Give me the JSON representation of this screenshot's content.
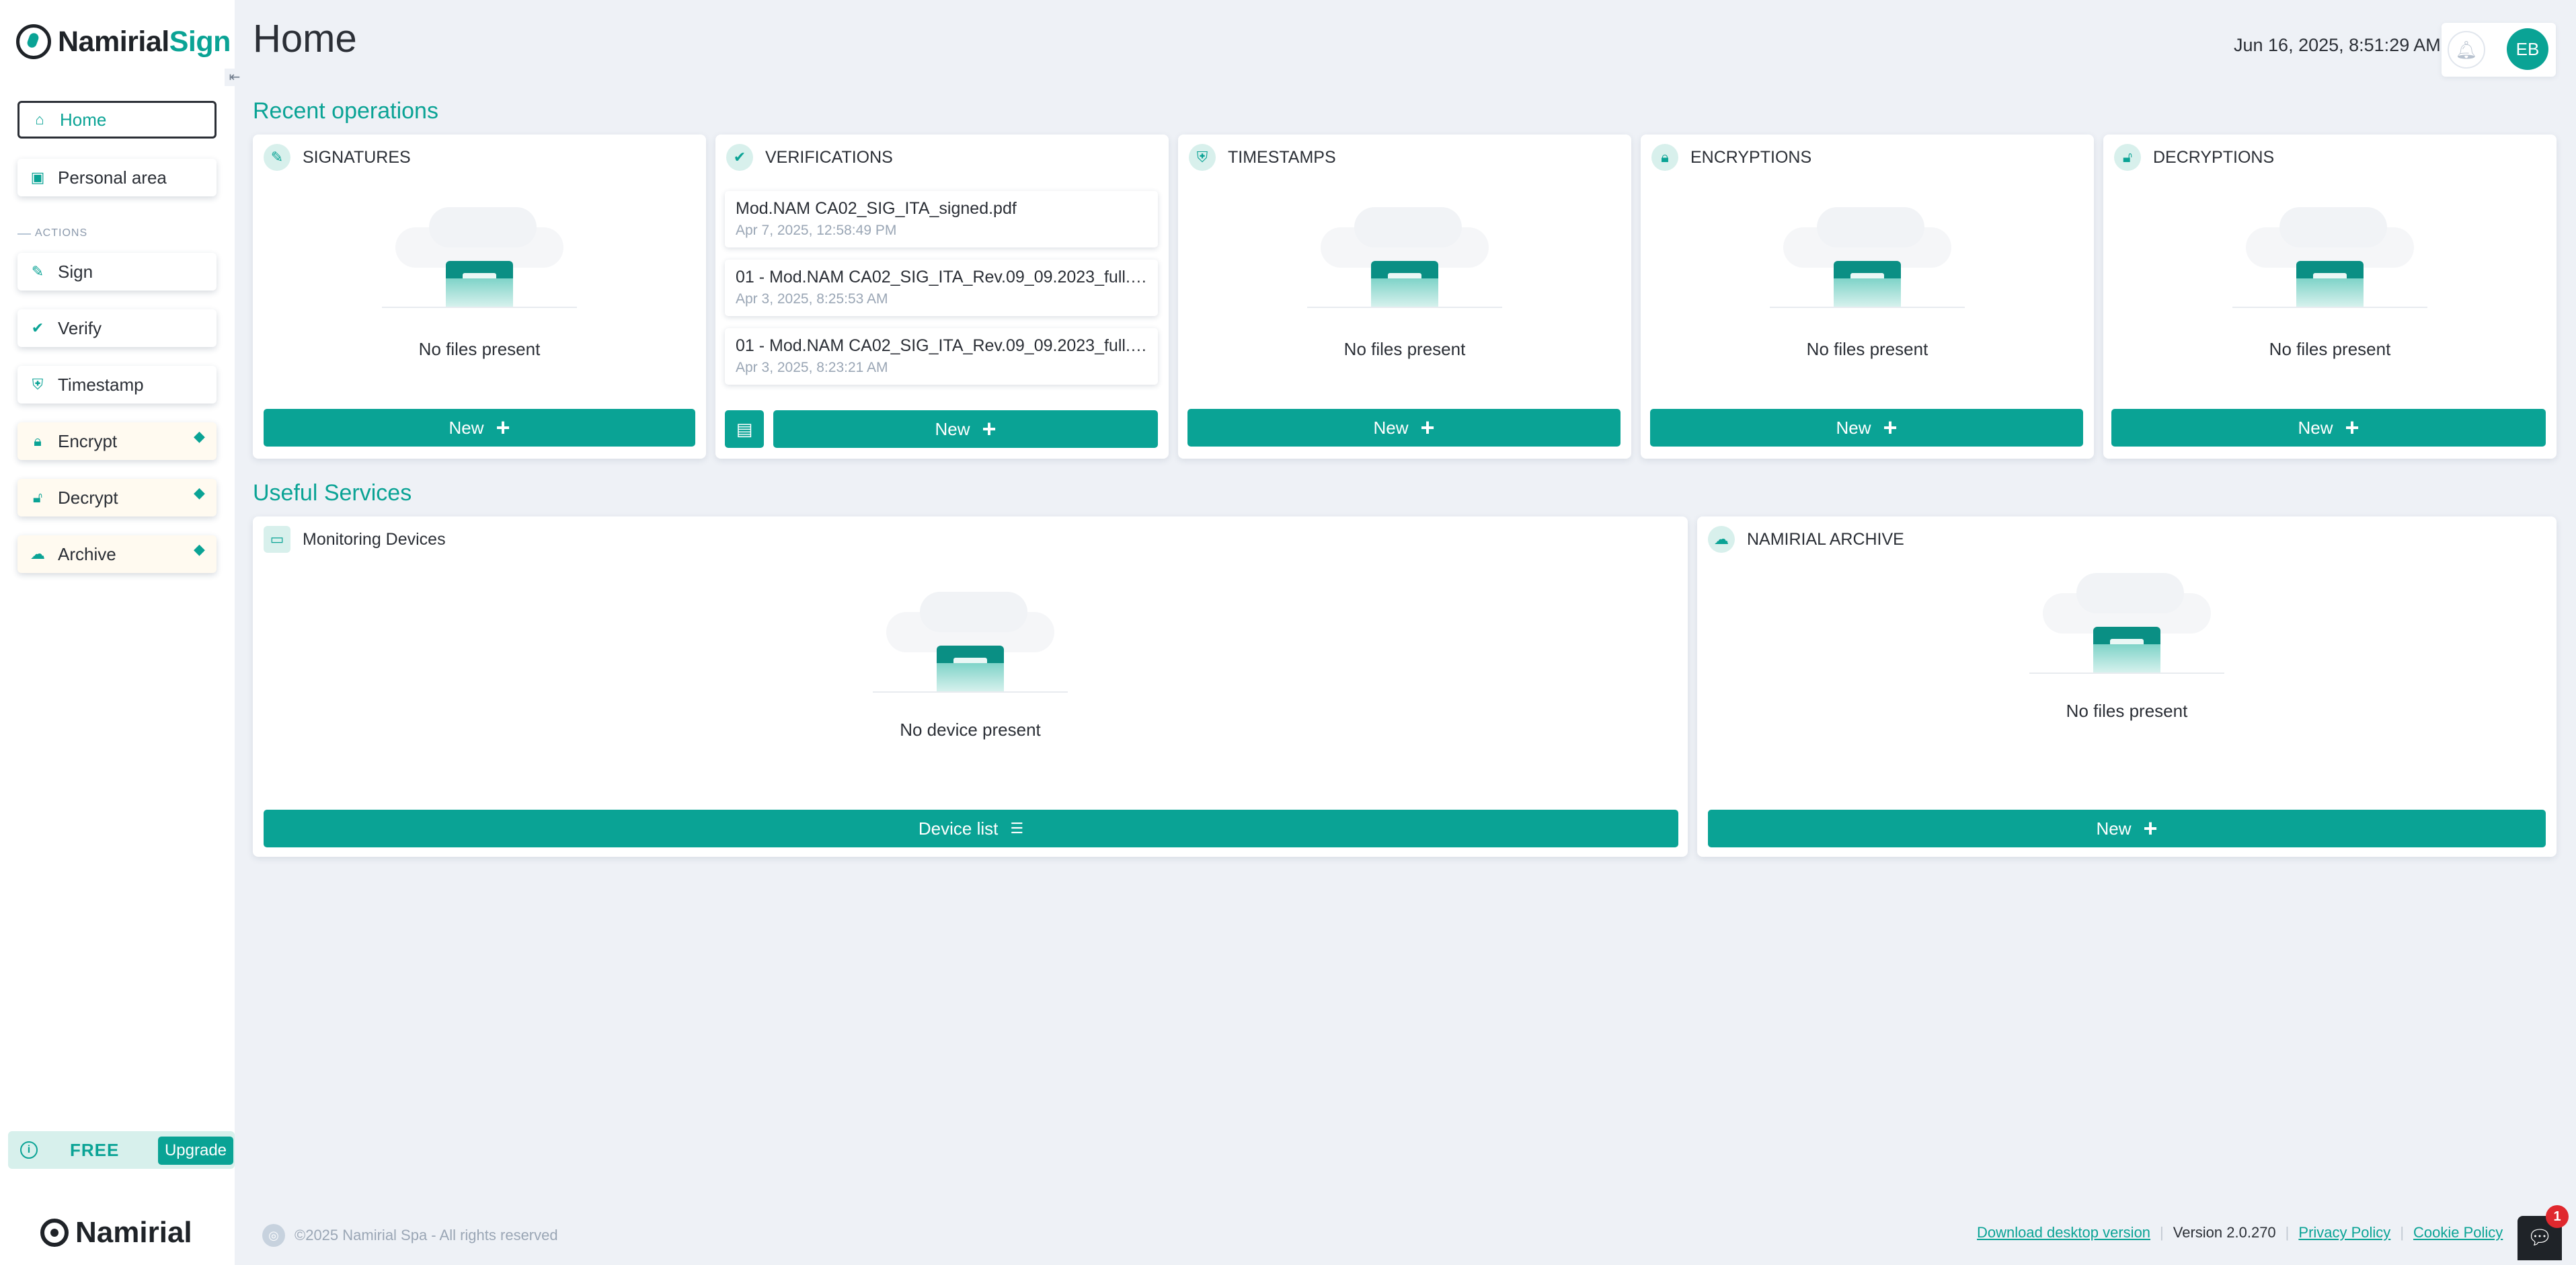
{
  "brand": {
    "name_main": "Namirial",
    "name_accent": "Sign",
    "footer_name": "Namirial"
  },
  "colors": {
    "accent": "#0aa395",
    "background": "#eef1f6",
    "premium_bg": "#fffaf0",
    "badge": "#e0282e"
  },
  "sidebar": {
    "items": [
      {
        "label": "Home",
        "icon": "home-icon"
      },
      {
        "label": "Personal area",
        "icon": "id-card-icon"
      }
    ],
    "section_label": "ACTIONS",
    "actions": [
      {
        "label": "Sign",
        "icon": "signature-icon",
        "premium": false
      },
      {
        "label": "Verify",
        "icon": "check-badge-icon",
        "premium": false
      },
      {
        "label": "Timestamp",
        "icon": "shield-clock-icon",
        "premium": false
      },
      {
        "label": "Encrypt",
        "icon": "lock-icon",
        "premium": true
      },
      {
        "label": "Decrypt",
        "icon": "unlock-icon",
        "premium": true
      },
      {
        "label": "Archive",
        "icon": "cloud-upload-icon",
        "premium": true
      }
    ],
    "plan": {
      "label": "FREE",
      "upgrade_label": "Upgrade"
    }
  },
  "header": {
    "title": "Home",
    "datetime": "Jun 16, 2025, 8:51:29 AM",
    "avatar_initials": "EB"
  },
  "recent": {
    "title": "Recent operations",
    "cards": [
      {
        "title": "SIGNATURES",
        "empty_text": "No files present",
        "button": "New"
      },
      {
        "title": "VERIFICATIONS",
        "button": "New",
        "files": [
          {
            "name": "Mod.NAM CA02_SIG_ITA_signed.pdf",
            "date": "Apr 7, 2025, 12:58:49 PM"
          },
          {
            "name": "01 - Mod.NAM CA02_SIG_ITA_Rev.09_09.2023_full.p...",
            "date": "Apr 3, 2025, 8:25:53 AM"
          },
          {
            "name": "01 - Mod.NAM CA02_SIG_ITA_Rev.09_09.2023_full.p...",
            "date": "Apr 3, 2025, 8:23:21 AM"
          }
        ]
      },
      {
        "title": "TIMESTAMPS",
        "empty_text": "No files present",
        "button": "New"
      },
      {
        "title": "ENCRYPTIONS",
        "empty_text": "No files present",
        "button": "New"
      },
      {
        "title": "DECRYPTIONS",
        "empty_text": "No files present",
        "button": "New"
      }
    ]
  },
  "services": {
    "title": "Useful Services",
    "monitoring": {
      "title": "Monitoring Devices",
      "empty_text": "No device present",
      "button": "Device list"
    },
    "archive": {
      "title": "NAMIRIAL ARCHIVE",
      "empty_text": "No files present",
      "button": "New"
    }
  },
  "footer": {
    "copyright": "©2025 Namirial Spa - All rights reserved",
    "download_link": "Download desktop version",
    "version": "Version 2.0.270",
    "privacy": "Privacy Policy",
    "cookie": "Cookie Policy",
    "chat_badge": "1"
  }
}
